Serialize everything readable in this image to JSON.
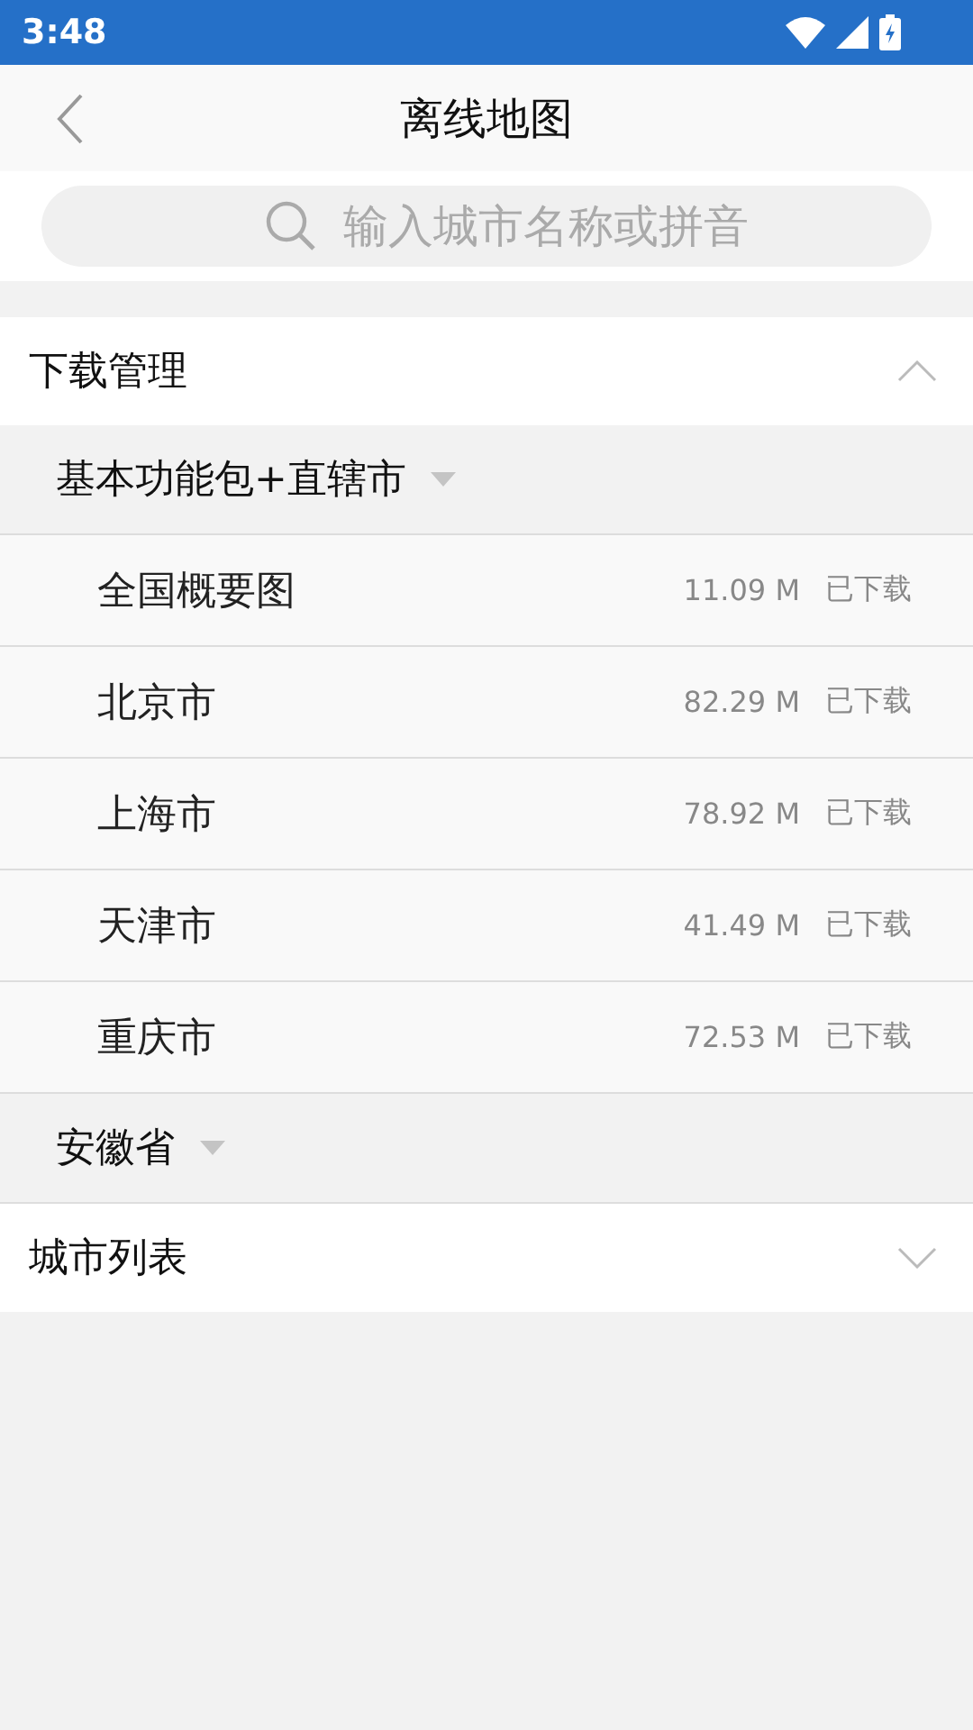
{
  "status_bar": {
    "time": "3:48"
  },
  "header": {
    "title": "离线地图"
  },
  "search": {
    "placeholder": "输入城市名称或拼音"
  },
  "sections": [
    {
      "title": "下载管理",
      "expanded": true,
      "groups": [
        {
          "name": "基本功能包+直辖市",
          "items": [
            {
              "name": "全国概要图",
              "size": "11.09 M",
              "status": "已下载"
            },
            {
              "name": "北京市",
              "size": "82.29 M",
              "status": "已下载"
            },
            {
              "name": "上海市",
              "size": "78.92 M",
              "status": "已下载"
            },
            {
              "name": "天津市",
              "size": "41.49 M",
              "status": "已下载"
            },
            {
              "name": "重庆市",
              "size": "72.53 M",
              "status": "已下载"
            }
          ]
        },
        {
          "name": "安徽省"
        }
      ]
    },
    {
      "title": "城市列表",
      "expanded": false
    }
  ]
}
